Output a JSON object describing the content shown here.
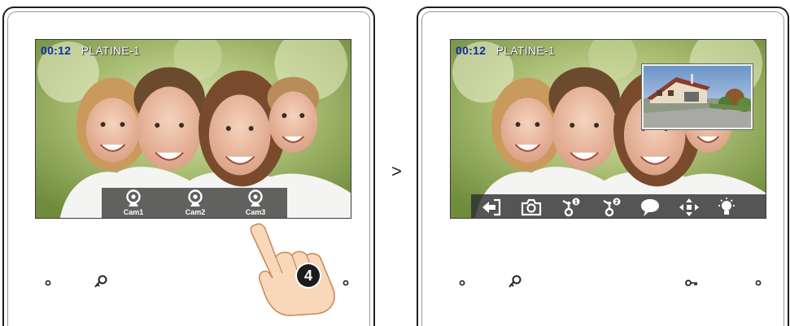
{
  "left_device": {
    "osd": {
      "time": "00:12",
      "name": "PLATINE-1"
    },
    "cameras": [
      {
        "label": "Cam1",
        "icon": "webcam-icon"
      },
      {
        "label": "Cam2",
        "icon": "webcam-icon"
      },
      {
        "label": "Cam3",
        "icon": "webcam-icon"
      }
    ],
    "step_badge": "4"
  },
  "separator": ">",
  "right_device": {
    "osd": {
      "time": "00:12",
      "name": "PLATINE-1"
    },
    "toolbar": [
      {
        "icon": "exit-icon"
      },
      {
        "icon": "camera-icon"
      },
      {
        "icon": "unlock-1-icon",
        "badge": "1"
      },
      {
        "icon": "unlock-2-icon",
        "badge": "2"
      },
      {
        "icon": "intercom-chat-icon"
      },
      {
        "icon": "settings-arrows-icon"
      },
      {
        "icon": "light-bulb-icon"
      }
    ]
  },
  "colors": {
    "time": "#0a2fa8",
    "frame": "#1e1e1e",
    "bar": "#373737"
  }
}
